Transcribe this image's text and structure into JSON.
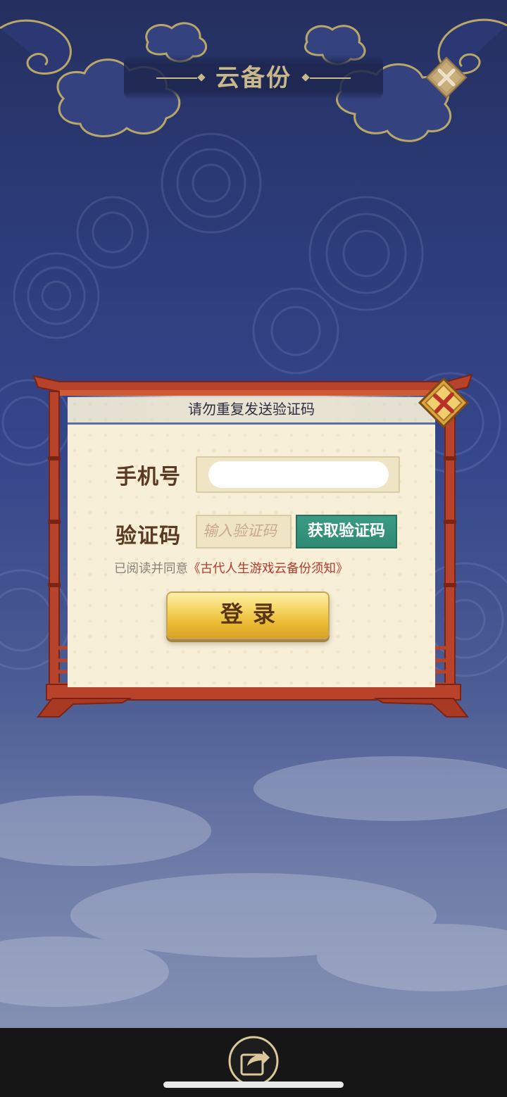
{
  "header": {
    "title": "云备份"
  },
  "dialog": {
    "notice": "请勿重复发送验证码",
    "phone_label": "手机号",
    "phone_value": "",
    "code_label": "验证码",
    "code_placeholder": "输入验证码",
    "get_code_label": "获取验证码",
    "agreement_prefix": "已阅读并同意",
    "agreement_link": "《古代人生游戏云备份须知》",
    "login_label": "登录"
  },
  "colors": {
    "background": "#2b3a76",
    "frame_red": "#b8432a",
    "panel": "#f7efd7",
    "accent_gold": "#c9b98a",
    "get_code_green": "#3b9b84",
    "login_gold": "#f6d766",
    "link_red": "#b23a2c"
  },
  "icons": {
    "header_close": "close-icon",
    "dialog_close": "close-icon",
    "share": "share-icon"
  }
}
